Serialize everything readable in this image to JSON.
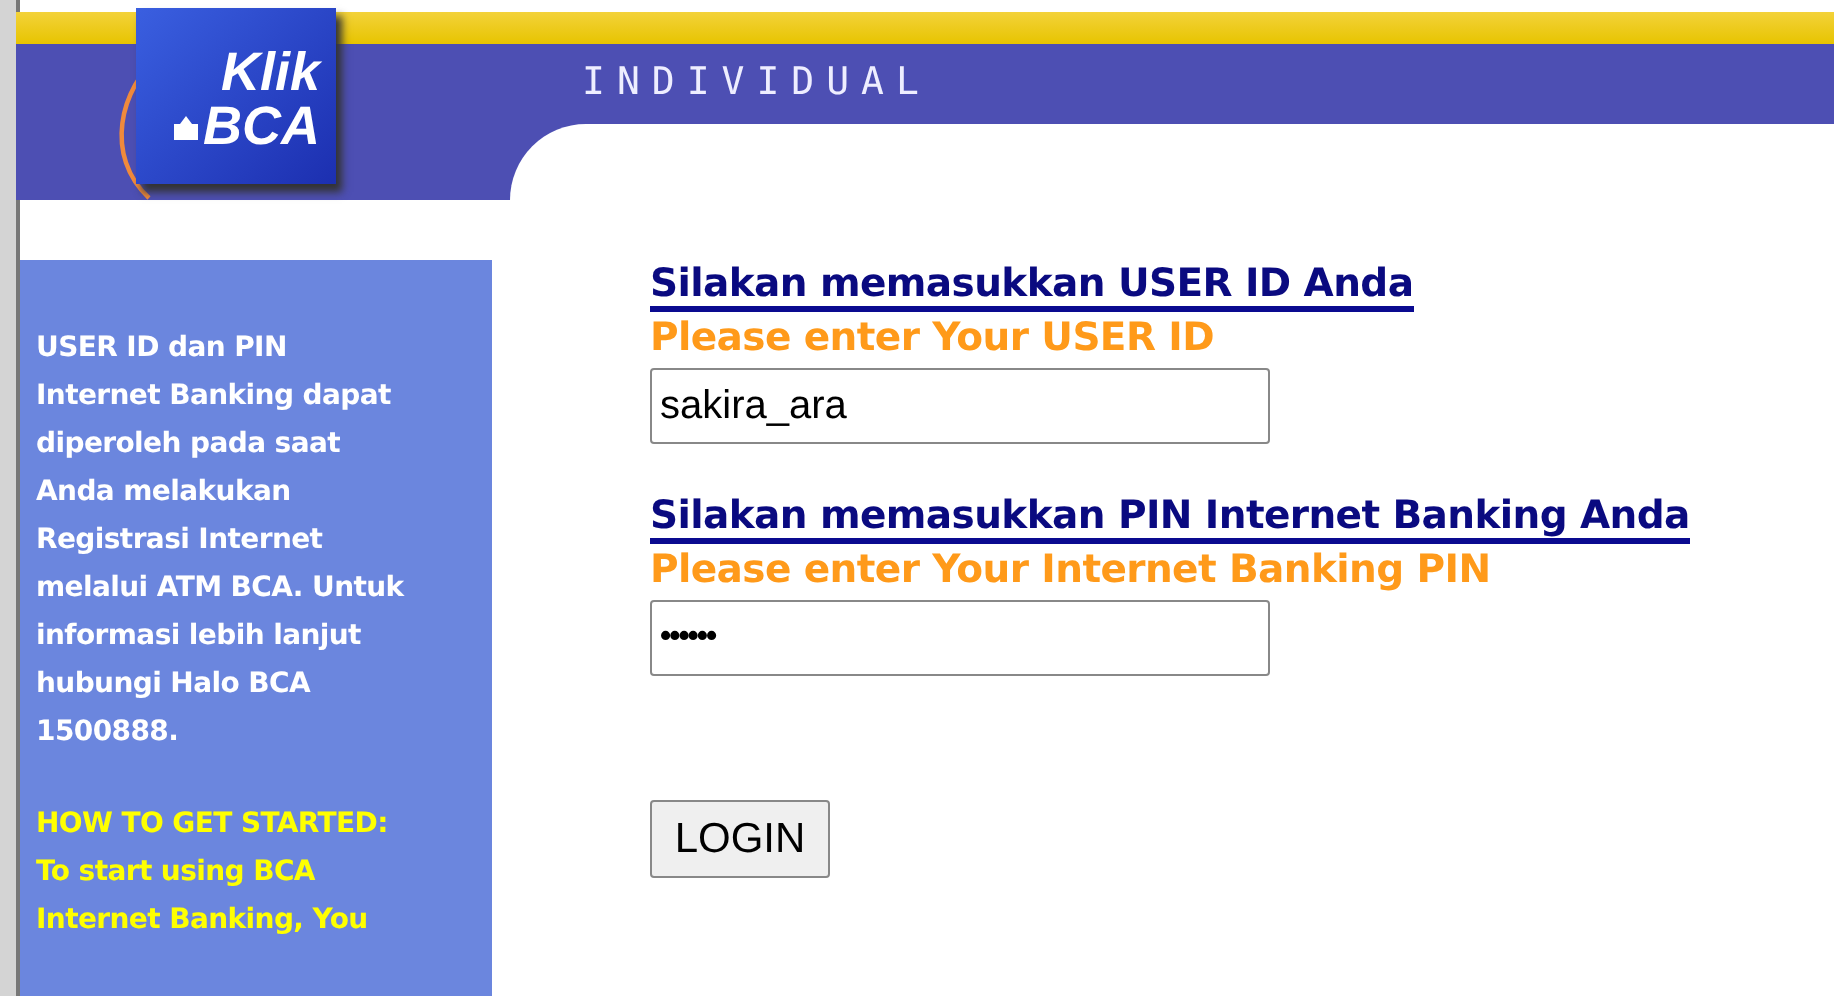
{
  "header": {
    "logo_top": "Klik",
    "logo_bottom": "BCA",
    "section": "INDIVIDUAL"
  },
  "sidebar": {
    "info_lines": [
      "USER ID dan PIN",
      "Internet Banking dapat",
      "diperoleh pada saat",
      "Anda melakukan",
      "Registrasi Internet",
      "melalui ATM BCA. Untuk",
      "informasi lebih lanjut",
      "hubungi Halo BCA",
      "1500888."
    ],
    "guide_lines": [
      "HOW TO GET STARTED:",
      "To start using BCA",
      "Internet Banking, You"
    ]
  },
  "fields": [
    {
      "label": "Silakan memasukkan USER ID Anda",
      "hint": "Please enter Your USER ID",
      "value": "sakira_ara",
      "kind": "text"
    },
    {
      "label": "Silakan memasukkan PIN Internet Banking Anda",
      "hint": "Please enter Your Internet Banking PIN",
      "value": "••••••",
      "kind": "password"
    }
  ],
  "button": "LOGIN"
}
